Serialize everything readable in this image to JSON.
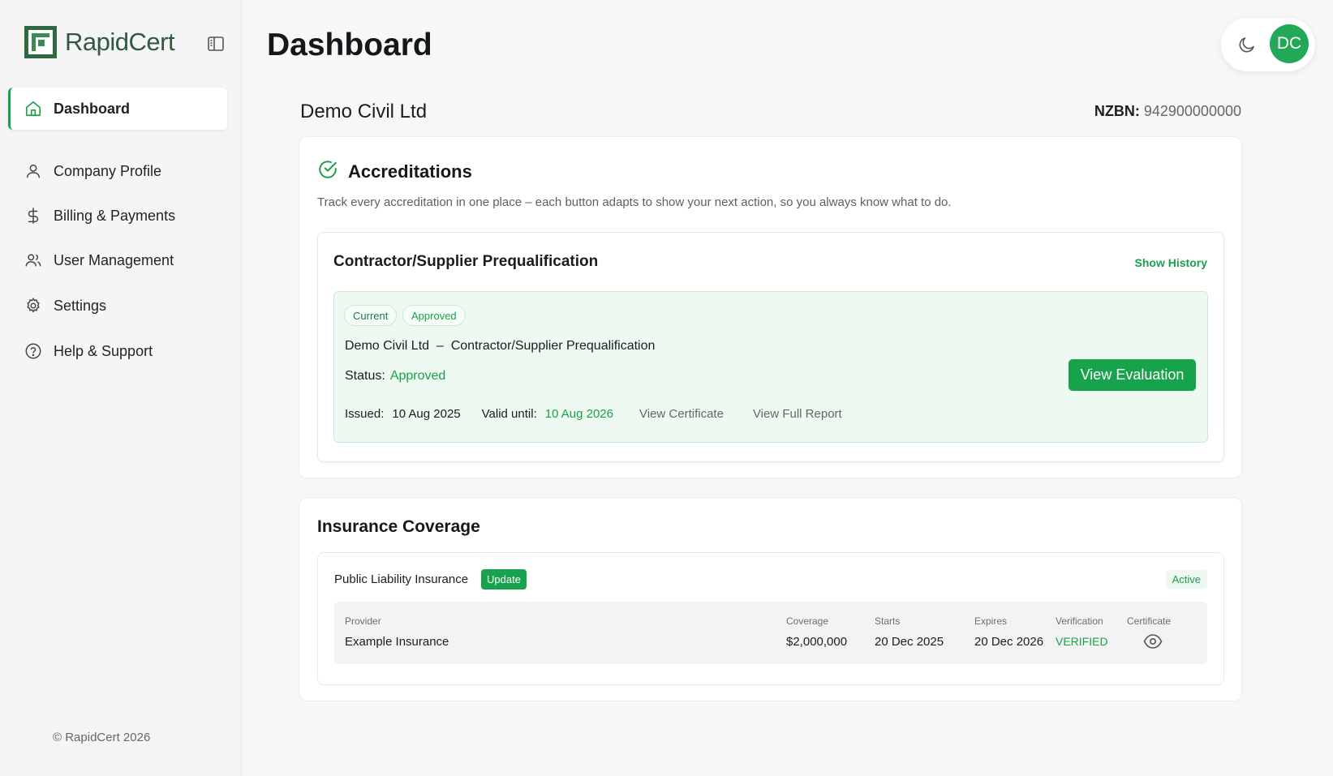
{
  "brand": {
    "name": "RapidCert"
  },
  "sidebar": {
    "items": [
      {
        "label": "Dashboard",
        "icon": "home-icon",
        "active": true
      },
      {
        "label": "Company Profile",
        "icon": "user-icon"
      },
      {
        "label": "Billing & Payments",
        "icon": "dollar-icon"
      },
      {
        "label": "User Management",
        "icon": "users-icon"
      },
      {
        "label": "Settings",
        "icon": "gear-icon"
      },
      {
        "label": "Help & Support",
        "icon": "help-circle-icon"
      }
    ],
    "copyright": "© RapidCert 2026"
  },
  "header": {
    "title": "Dashboard",
    "avatar_initials": "DC"
  },
  "company": {
    "name": "Demo Civil Ltd",
    "nzbn_label": "NZBN:",
    "nzbn_value": "942900000000"
  },
  "accreditations": {
    "title": "Accreditations",
    "description": "Track every accreditation in one place – each button adapts to show your next action, so you always know what to do.",
    "program": {
      "title": "Contractor/Supplier Prequalification",
      "show_history": "Show History",
      "record": {
        "badges": [
          "Current",
          "Approved"
        ],
        "name": "Demo Civil Ltd  –  Contractor/Supplier Prequalification",
        "status_label": "Status:",
        "status_value": "Approved",
        "issued_label": "Issued:",
        "issued_value": "10 Aug 2025",
        "valid_label": "Valid until:",
        "valid_value": "10 Aug 2026",
        "view_certificate": "View Certificate",
        "view_report": "View Full Report",
        "action_button": "View Evaluation"
      }
    }
  },
  "insurance": {
    "title": "Insurance Coverage",
    "policy": {
      "name": "Public Liability Insurance",
      "update_label": "Update",
      "state": "Active",
      "columns": {
        "provider": {
          "header": "Provider",
          "value": "Example Insurance"
        },
        "coverage": {
          "header": "Coverage",
          "value": "$2,000,000"
        },
        "starts": {
          "header": "Starts",
          "value": "20 Dec 2025"
        },
        "expires": {
          "header": "Expires",
          "value": "20 Dec 2026"
        },
        "verification": {
          "header": "Verification",
          "value": "VERIFIED"
        },
        "certificate": {
          "header": "Certificate",
          "icon": "eye-icon"
        }
      }
    }
  },
  "colors": {
    "accent": "#1c9e4d",
    "brand": "#2f5a3e",
    "avatar": "#22a957"
  }
}
